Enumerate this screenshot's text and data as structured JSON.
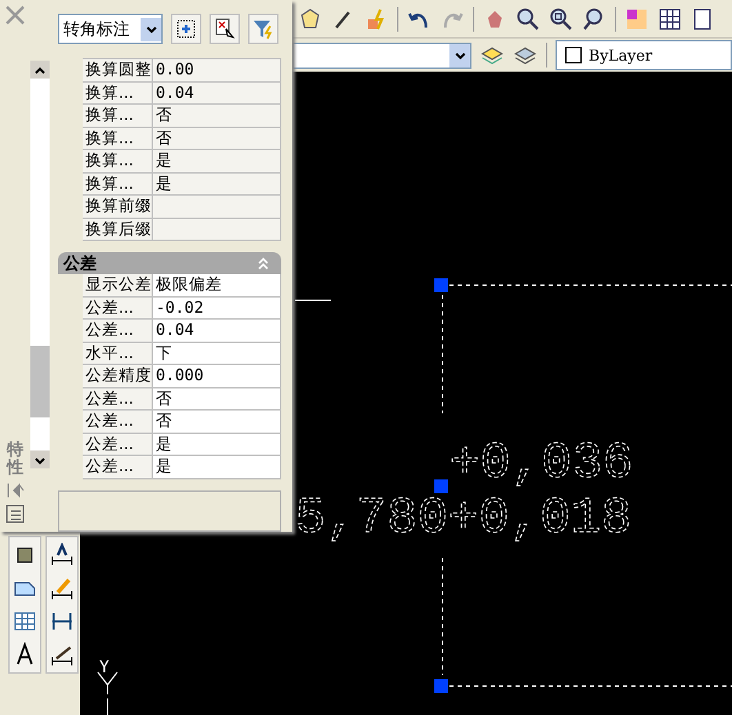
{
  "palette": {
    "title": "特性",
    "object_type": "转角标注",
    "rows": [
      {
        "label": "换算圆整",
        "value": "0.00"
      },
      {
        "label": "换算...",
        "value": "0.04"
      },
      {
        "label": "换算...",
        "value": "否"
      },
      {
        "label": "换算...",
        "value": "否"
      },
      {
        "label": "换算...",
        "value": "是"
      },
      {
        "label": "换算...",
        "value": "是"
      },
      {
        "label": "换算前缀",
        "value": ""
      },
      {
        "label": "换算后缀",
        "value": ""
      }
    ],
    "section": {
      "title": "公差",
      "expanded": true,
      "rows": [
        {
          "label": "显示公差",
          "value": "极限偏差"
        },
        {
          "label": "公差...",
          "value": "-0.02"
        },
        {
          "label": "公差...",
          "value": "0.04"
        },
        {
          "label": "水平...",
          "value": "下"
        },
        {
          "label": "公差精度",
          "value": "0.000"
        },
        {
          "label": "公差...",
          "value": "否"
        },
        {
          "label": "公差...",
          "value": "否"
        },
        {
          "label": "公差...",
          "value": "是"
        },
        {
          "label": "公差...",
          "value": "是"
        }
      ]
    }
  },
  "color_control": {
    "value": "ByLayer"
  },
  "drawing": {
    "texts": [
      "+0,036",
      "5,780+0,018"
    ],
    "axis_label": "Y"
  }
}
